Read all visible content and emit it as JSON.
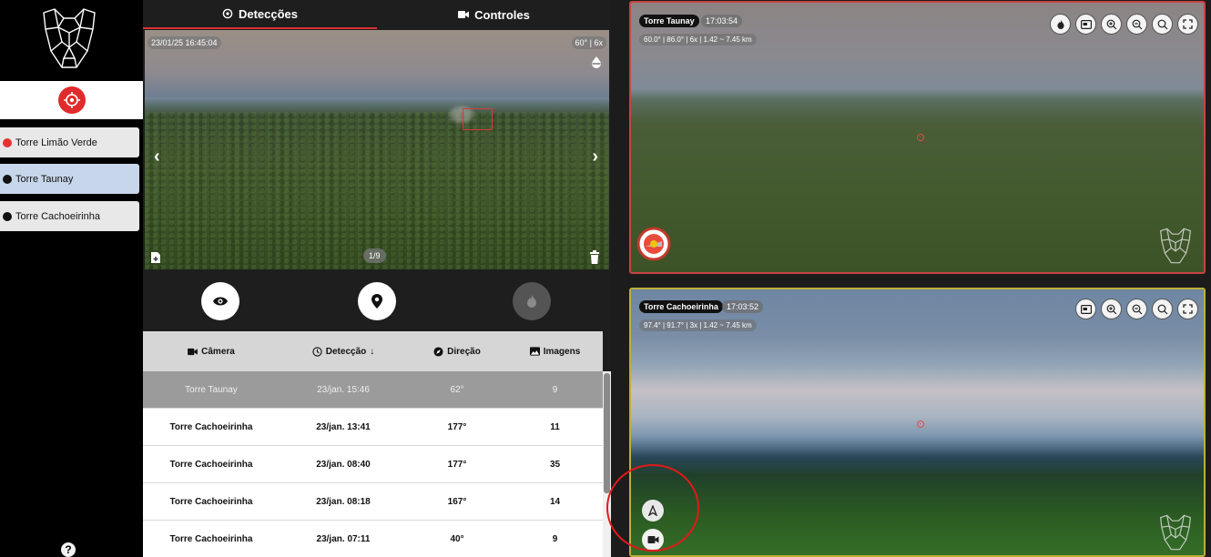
{
  "sidebar": {
    "towers": [
      {
        "label": "Torre Limão Verde",
        "status_color": "#e53131"
      },
      {
        "label": "Torre Taunay",
        "status_color": "#111111"
      },
      {
        "label": "Torre Cachoeirinha",
        "status_color": "#111111"
      }
    ],
    "help_label": "?"
  },
  "tabs": [
    {
      "label": "Detecções",
      "icon": "target-icon"
    },
    {
      "label": "Controles",
      "icon": "video-camera-icon"
    }
  ],
  "detection_image": {
    "timestamp": "23/01/25 16:45:04",
    "zoom_badge": "60° | 6x",
    "counter": "1/9"
  },
  "detection_table": {
    "headers": [
      "Câmera",
      "Detecção",
      "Direção",
      "Imagens"
    ],
    "rows": [
      {
        "camera": "Torre Taunay",
        "time": "23/jan. 15:46",
        "direction": "62°",
        "images": "9"
      },
      {
        "camera": "Torre Cachoeirinha",
        "time": "23/jan. 13:41",
        "direction": "177°",
        "images": "11"
      },
      {
        "camera": "Torre Cachoeirinha",
        "time": "23/jan. 08:40",
        "direction": "177°",
        "images": "35"
      },
      {
        "camera": "Torre Cachoeirinha",
        "time": "23/jan. 08:18",
        "direction": "167°",
        "images": "14"
      },
      {
        "camera": "Torre Cachoeirinha",
        "time": "23/jan. 07:11",
        "direction": "40°",
        "images": "9"
      }
    ]
  },
  "cameras": [
    {
      "name": "Torre Taunay",
      "time": "17:03:54",
      "info": "60.0° | 86.0° | 6x | 1.42 ~ 7.45 km"
    },
    {
      "name": "Torre Cachoeirinha",
      "time": "17:03:52",
      "info": "97.4° | 91.7° | 3x | 1.42 ~ 7.45 km"
    }
  ],
  "colors": {
    "accent_red": "#d93232",
    "selected_tower": "#c7d6ea",
    "cam1_border": "#c84444",
    "cam2_border": "#bfae3a"
  }
}
